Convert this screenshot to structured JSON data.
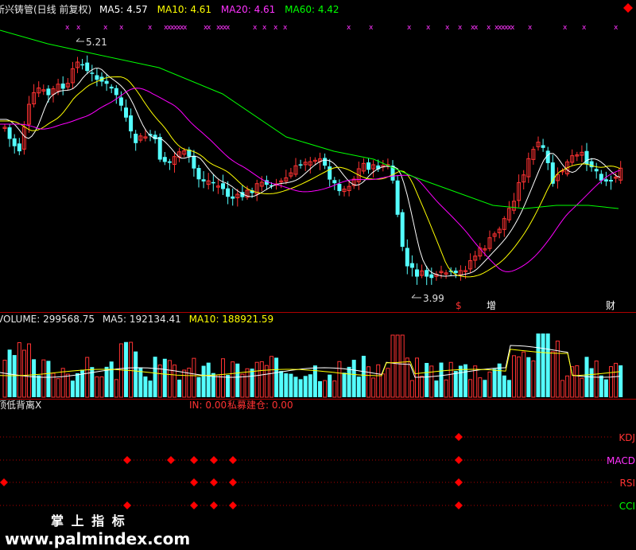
{
  "header": {
    "title": "新兴铸管(日线 前复权)",
    "ma5": "MA5: 4.57",
    "ma10": "MA10: 4.61",
    "ma20": "MA20: 4.61",
    "ma60": "MA60: 4.42",
    "corner_icon": "diamond-icon"
  },
  "price_panel": {
    "high_label": "5.21",
    "low_label": "3.99",
    "markers": [
      "$",
      "增",
      "财"
    ]
  },
  "volume_panel": {
    "volume": "VOLUME: 299568.75",
    "ma5": "MA5: 192134.41",
    "ma10": "MA10: 188921.59"
  },
  "indicator_panel": {
    "title": "顶低背离X",
    "in_value": "IN: 0.00",
    "private_fund": "私募建仓: 0.00",
    "rows": [
      "KDJ",
      "MACD",
      "RSI",
      "CCI"
    ]
  },
  "watermark": {
    "title": "掌 上 指 标",
    "url": "www.palmindex.com"
  },
  "colors": {
    "up": "#ff3232",
    "down": "#54ffff",
    "ma5": "#ffffff",
    "ma10": "#ffff00",
    "ma20": "#ff00ff",
    "ma60": "#00ff00",
    "signal": "#ff0000",
    "frame": "#b00000"
  },
  "chart_data": {
    "type": "candlestick",
    "price_range": [
      3.8,
      5.35
    ],
    "highlighted_values": {
      "high": 5.21,
      "low": 3.99
    }
  }
}
